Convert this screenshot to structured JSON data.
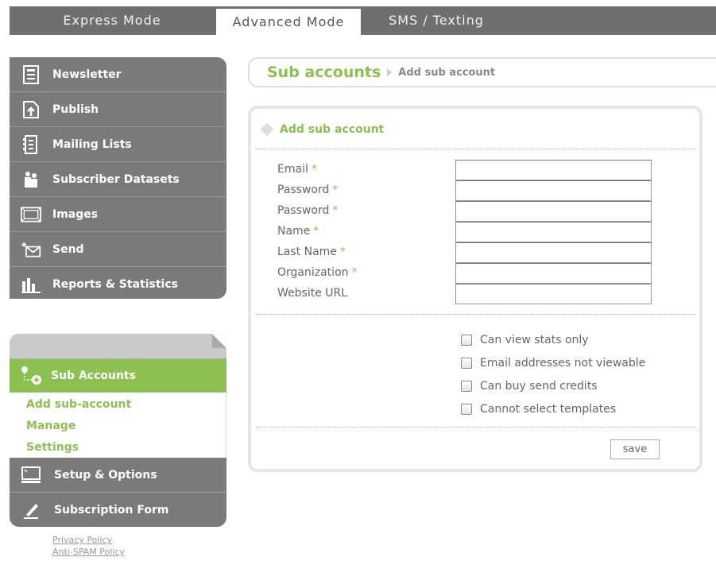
{
  "top_tabs": [
    {
      "label": "Express Mode"
    },
    {
      "label": "Advanced Mode"
    },
    {
      "label": "SMS / Texting"
    }
  ],
  "nav": {
    "items": [
      {
        "label": "Newsletter",
        "icon": "newsletter-icon"
      },
      {
        "label": "Publish",
        "icon": "publish-icon"
      },
      {
        "label": "Mailing Lists",
        "icon": "mailing-lists-icon"
      },
      {
        "label": "Subscriber Datasets",
        "icon": "users-icon"
      },
      {
        "label": "Images",
        "icon": "film-icon"
      },
      {
        "label": "Send",
        "icon": "envelope-icon"
      },
      {
        "label": "Reports & Statistics",
        "icon": "bar-chart-icon"
      }
    ]
  },
  "sub_accounts": {
    "header": "Sub Accounts",
    "links": [
      "Add sub-account",
      "Manage",
      "Settings"
    ]
  },
  "nav2": {
    "items": [
      {
        "label": "Setup & Options",
        "icon": "monitor-icon"
      },
      {
        "label": "Subscription Form",
        "icon": "pen-icon"
      }
    ]
  },
  "footer": {
    "links": [
      "Privacy Policy",
      "Anti-SPAM Policy"
    ]
  },
  "breadcrumb": {
    "parent": "Sub accounts",
    "current": "Add sub account"
  },
  "form": {
    "title": "Add sub account",
    "required_mark": "*",
    "fields": [
      {
        "label": "Email",
        "required": true,
        "value": ""
      },
      {
        "label": "Password",
        "required": true,
        "value": ""
      },
      {
        "label": "Password",
        "required": true,
        "value": ""
      },
      {
        "label": "Name",
        "required": true,
        "value": ""
      },
      {
        "label": "Last Name",
        "required": true,
        "value": ""
      },
      {
        "label": "Organization",
        "required": true,
        "value": ""
      },
      {
        "label": "Website URL",
        "required": false,
        "value": ""
      }
    ],
    "checkboxes": [
      {
        "label": "Can view stats only",
        "checked": false
      },
      {
        "label": "Email addresses not viewable",
        "checked": false
      },
      {
        "label": "Can buy send credits",
        "checked": false
      },
      {
        "label": "Cannot select templates",
        "checked": false
      }
    ],
    "save_label": "save"
  },
  "colors": {
    "accent_green": "#8cc152",
    "nav_gray": "#7a7a7a",
    "topbar_gray": "#6f6f6f"
  }
}
